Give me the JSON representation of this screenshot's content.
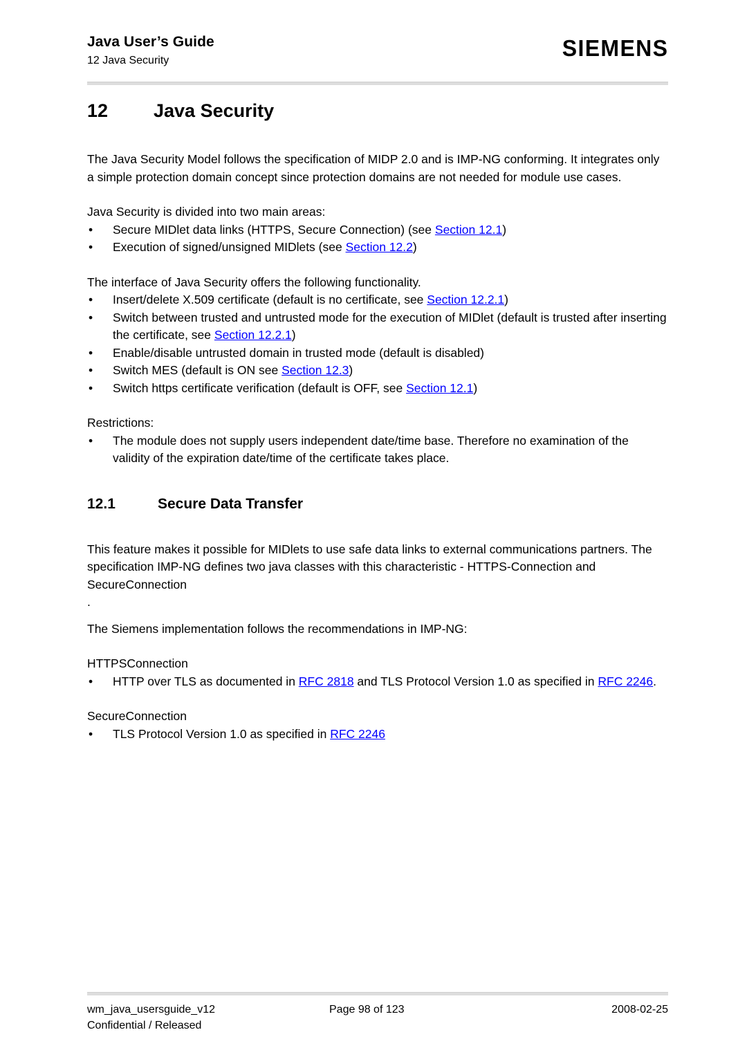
{
  "header": {
    "title": "Java User’s Guide",
    "subtitle": "12 Java Security",
    "brand": "SIEMENS"
  },
  "chapter": {
    "number": "12",
    "title": "Java Security"
  },
  "intro_paragraph": "The Java Security Model follows the specification of MIDP 2.0 and is IMP-NG conforming. It integrates only a simple protection domain concept since protection domains are not needed for module use cases.",
  "areas": {
    "lead": "Java Security is divided into two main areas:",
    "bullet_marker": "•",
    "items": [
      {
        "before": "Secure MIDlet data links (HTTPS, Secure Connection) (see ",
        "link": "Section 12.1",
        "after": ")"
      },
      {
        "before": "Execution of signed/unsigned MIDlets (see ",
        "link": "Section 12.2",
        "after": ")"
      }
    ]
  },
  "functionality": {
    "lead": "The interface of Java Security offers the following functionality.",
    "items": [
      {
        "before": "Insert/delete X.509 certificate (default is no certificate, see ",
        "link": "Section 12.2.1",
        "after": ")"
      },
      {
        "before": "Switch between trusted and untrusted mode for the execution of MIDlet (default is trusted after inserting the certificate, see ",
        "link": "Section 12.2.1",
        "after": ")"
      },
      {
        "before": "Enable/disable untrusted domain in trusted mode (default is disabled)",
        "link": "",
        "after": ""
      },
      {
        "before": "Switch MES (default is ON see ",
        "link": "Section 12.3",
        "after": ")"
      },
      {
        "before": "Switch https certificate verification (default is OFF, see ",
        "link": "Section 12.1",
        "after": ")"
      }
    ]
  },
  "restrictions": {
    "lead": "Restrictions:",
    "items": [
      {
        "before": "The module does not supply users independent date/time base. Therefore no examination of the validity of the expiration date/time of the certificate takes place.",
        "link": "",
        "after": ""
      }
    ]
  },
  "section_12_1": {
    "number": "12.1",
    "title": "Secure Data Transfer",
    "paragraph_1": "This feature makes it possible for MIDlets to use safe data links to external communications partners. The specification IMP-NG defines two java classes with this characteristic - HTTPS-Connection and SecureConnection",
    "stray_period": ".",
    "paragraph_2": "The Siemens implementation follows the recommendations in IMP-NG:",
    "https_heading": "HTTPSConnection",
    "https_bullet": {
      "part_1": "HTTP over TLS as documented in ",
      "link_1": "RFC 2818",
      "part_2": " and TLS Protocol Version 1.0 as specified in ",
      "link_2": "RFC 2246",
      "part_3": "."
    },
    "secure_heading": "SecureConnection",
    "secure_bullet": {
      "part_1": "TLS Protocol Version 1.0 as specified in ",
      "link_1": "RFC 2246",
      "part_2": ""
    }
  },
  "footer": {
    "doc_id": "wm_java_usersguide_v12",
    "classification": "Confidential / Released",
    "page": "Page 98 of 123",
    "date": "2008-02-25"
  },
  "colors": {
    "link": "#0000FF",
    "rule": "#DDDDDD",
    "text": "#000000"
  }
}
